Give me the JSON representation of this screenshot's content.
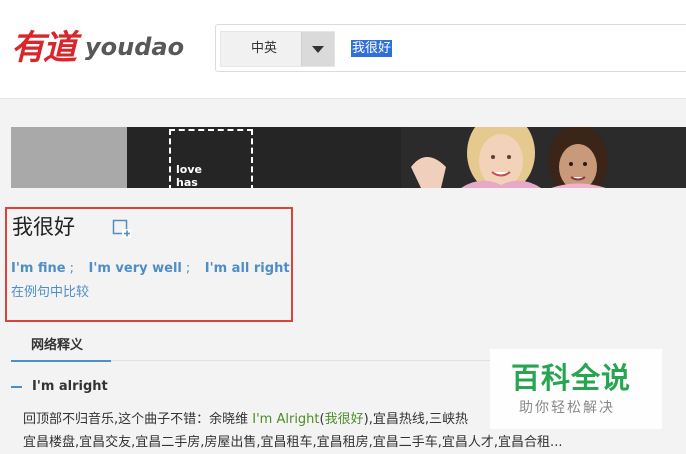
{
  "header": {
    "logo_cn": "有道",
    "logo_en": "youdao",
    "language_select": "中英",
    "query": "我很好"
  },
  "banner": {
    "ad_text_1": "love",
    "ad_text_2": "has"
  },
  "result": {
    "word": "我很好",
    "translations": [
      "I'm fine",
      "I'm very well",
      "I'm all right"
    ],
    "separator": ";",
    "compare_link": "在例句中比较"
  },
  "tabs": {
    "web_definitions": "网络释义"
  },
  "web_entry": {
    "title": "I'm alright",
    "line1_prefix": "回顶部不归音乐,这个曲子不错：余晓维 ",
    "line1_highlight_en": "I'm Alright",
    "line1_highlight_cn_open": "(",
    "line1_highlight_cn": "我很好",
    "line1_highlight_cn_close": ")",
    "line1_suffix": ",宜昌热线,三峡热",
    "line2": "宜昌楼盘,宜昌交友,宜昌二手房,房屋出售,宜昌租车,宜昌租房,宜昌二手车,宜昌人才,宜昌合租..."
  },
  "watermark": {
    "title": "百科全说",
    "subtitle": "助你轻松解决"
  },
  "colors": {
    "logo_red": "#d8262a",
    "link_blue": "#4f8ec4",
    "highlight_green": "#4f8c2b",
    "frame_red": "#d9433c",
    "watermark_green": "#27a551",
    "selection_blue": "#2f6fdc"
  }
}
